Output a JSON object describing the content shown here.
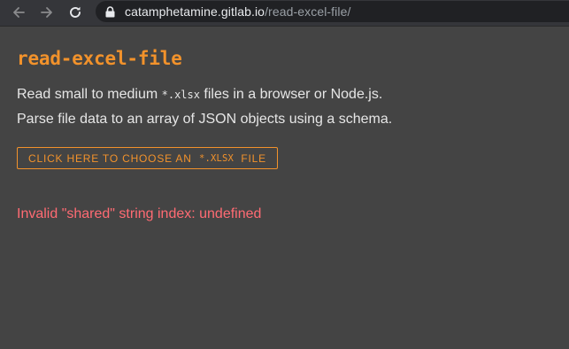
{
  "browser": {
    "url_host": "catamphetamine.gitlab.io",
    "url_path": "/read-excel-file/",
    "icons": {
      "back": "arrow-left-icon",
      "forward": "arrow-right-icon",
      "reload": "reload-icon",
      "lock": "lock-icon"
    }
  },
  "page": {
    "title": "read-excel-file",
    "description_line1_before": "Read small to medium ",
    "description_line1_code": "*.xlsx",
    "description_line1_after": " files in a browser or Node.js.",
    "description_line2": "Parse file data to an array of JSON objects using a schema.",
    "choose_button_before": "CLICK HERE TO CHOOSE AN ",
    "choose_button_code": "*.XLSX",
    "choose_button_after": " FILE",
    "error_message": "Invalid \"shared\" string index: undefined"
  },
  "colors": {
    "background": "#444444",
    "accent": "#f2922b",
    "error": "#ff6b73",
    "text": "#e6e6e6"
  }
}
